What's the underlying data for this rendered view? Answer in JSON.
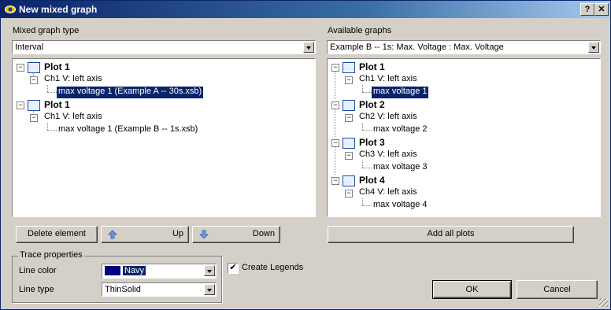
{
  "window": {
    "title": "New mixed graph",
    "help_label": "?",
    "close_label": "✕"
  },
  "left": {
    "type_label": "Mixed graph type",
    "type_value": "Interval",
    "tree": [
      {
        "plot": "Plot 1",
        "axis": "Ch1 V: left axis",
        "trace": "max voltage 1  (Example A -- 30s.xsb)"
      },
      {
        "plot": "Plot 1",
        "axis": "Ch1 V: left axis",
        "trace": "max voltage 1  (Example B -- 1s.xsb)"
      }
    ]
  },
  "right": {
    "graphs_label": "Available graphs",
    "graphs_value": "Example B -- 1s: Max. Voltage : Max. Voltage",
    "tree": [
      {
        "plot": "Plot 1",
        "axis": "Ch1 V: left axis",
        "trace": "max voltage 1"
      },
      {
        "plot": "Plot 2",
        "axis": "Ch2 V: left axis",
        "trace": "max voltage 2"
      },
      {
        "plot": "Plot 3",
        "axis": "Ch3 V: left axis",
        "trace": "max voltage 3"
      },
      {
        "plot": "Plot 4",
        "axis": "Ch4 V: left axis",
        "trace": "max voltage 4"
      }
    ]
  },
  "buttons": {
    "delete": "Delete element",
    "up": "Up",
    "down": "Down",
    "add_all": "Add all plots",
    "ok": "OK",
    "cancel": "Cancel"
  },
  "trace_properties": {
    "group_label": "Trace properties",
    "line_color_label": "Line color",
    "line_color_value": "Navy",
    "line_type_label": "Line type",
    "line_type_value": "ThinSolid"
  },
  "legends": {
    "label": "Create Legends",
    "checked": true,
    "check_glyph": "✔"
  },
  "colors": {
    "selection": "#0a246a",
    "navy": "#000080",
    "face": "#d4d0c8"
  },
  "icons": [
    "app-icon",
    "help-icon",
    "close-icon",
    "plot-icon",
    "up-arrow-icon",
    "down-arrow-icon",
    "expander-minus-icon",
    "size-grip-icon"
  ]
}
